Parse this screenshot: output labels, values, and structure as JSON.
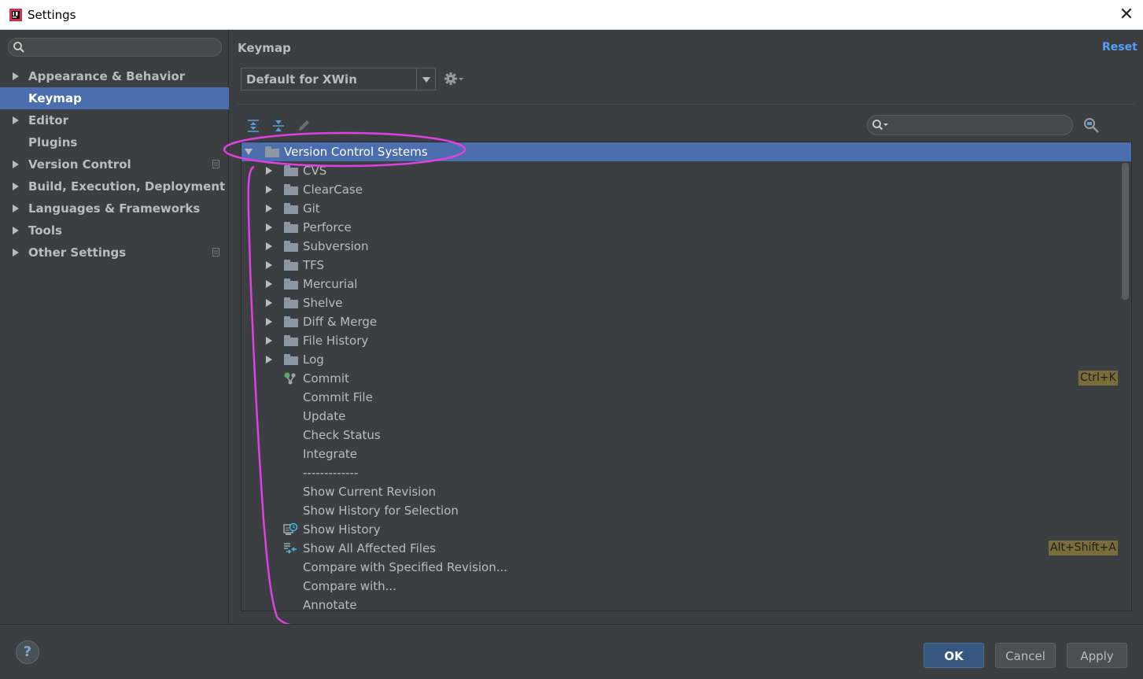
{
  "window": {
    "title": "Settings",
    "close_glyph": "✕",
    "app_icon": "intellij-icon"
  },
  "sidebar": {
    "search": {
      "value": "",
      "placeholder": ""
    },
    "items": [
      {
        "label": "Appearance & Behavior",
        "expandable": true,
        "selected": false,
        "copy_icon": false
      },
      {
        "label": "Keymap",
        "expandable": false,
        "selected": true,
        "copy_icon": false
      },
      {
        "label": "Editor",
        "expandable": true,
        "selected": false,
        "copy_icon": false
      },
      {
        "label": "Plugins",
        "expandable": false,
        "selected": false,
        "copy_icon": false
      },
      {
        "label": "Version Control",
        "expandable": true,
        "selected": false,
        "copy_icon": true
      },
      {
        "label": "Build, Execution, Deployment",
        "expandable": true,
        "selected": false,
        "copy_icon": false
      },
      {
        "label": "Languages & Frameworks",
        "expandable": true,
        "selected": false,
        "copy_icon": false
      },
      {
        "label": "Tools",
        "expandable": true,
        "selected": false,
        "copy_icon": false
      },
      {
        "label": "Other Settings",
        "expandable": true,
        "selected": false,
        "copy_icon": true
      }
    ]
  },
  "main": {
    "title": "Keymap",
    "reset_label": "Reset",
    "keymap_combo": {
      "value": "Default for XWin"
    },
    "tree_search": {
      "value": "",
      "placeholder": ""
    },
    "tree": {
      "root": {
        "label": "Version Control Systems",
        "expanded": true,
        "selected": true
      },
      "folders": [
        "CVS",
        "ClearCase",
        "Git",
        "Perforce",
        "Subversion",
        "TFS",
        "Mercurial",
        "Shelve",
        "Diff & Merge",
        "File History",
        "Log"
      ],
      "actions": [
        {
          "label": "Commit",
          "icon": "commit-icon",
          "shortcut": "Ctrl+K"
        },
        {
          "label": "Commit File",
          "icon": "",
          "shortcut": ""
        },
        {
          "label": "Update",
          "icon": "",
          "shortcut": ""
        },
        {
          "label": "Check Status",
          "icon": "",
          "shortcut": ""
        },
        {
          "label": "Integrate",
          "icon": "",
          "shortcut": ""
        },
        {
          "label": "-------------",
          "icon": "",
          "shortcut": ""
        },
        {
          "label": "Show Current Revision",
          "icon": "",
          "shortcut": ""
        },
        {
          "label": "Show History for Selection",
          "icon": "",
          "shortcut": ""
        },
        {
          "label": "Show History",
          "icon": "history-icon",
          "shortcut": ""
        },
        {
          "label": "Show All Affected Files",
          "icon": "affected-files-icon",
          "shortcut": "Alt+Shift+A"
        },
        {
          "label": "Compare with Specified Revision...",
          "icon": "",
          "shortcut": ""
        },
        {
          "label": "Compare with...",
          "icon": "",
          "shortcut": ""
        },
        {
          "label": "Annotate",
          "icon": "",
          "shortcut": ""
        }
      ]
    }
  },
  "footer": {
    "help_label": "?",
    "ok_label": "OK",
    "cancel_label": "Cancel",
    "apply_label": "Apply"
  },
  "colors": {
    "background": "#3c3f41",
    "selection": "#4b6eaf",
    "text": "#bbbbbb",
    "link": "#589df6",
    "shortcut_highlight": "#7a6d3a",
    "annotation": "#e040e0",
    "ok_button": "#365880"
  }
}
